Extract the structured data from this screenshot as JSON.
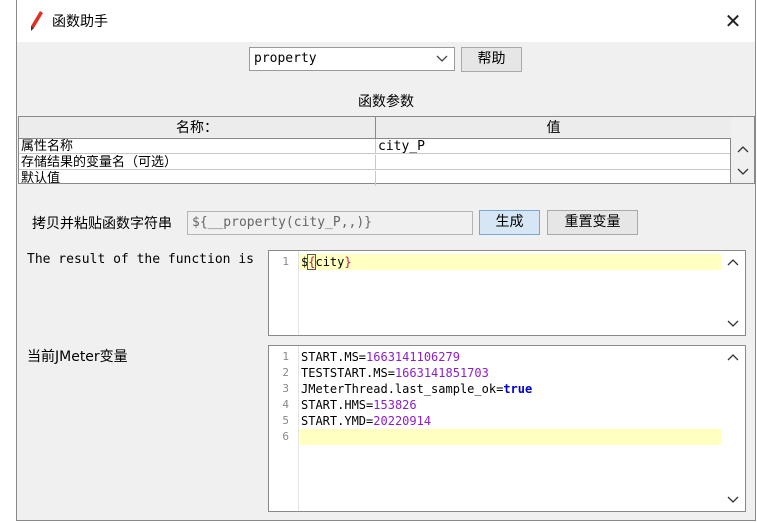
{
  "window": {
    "title": "函数助手",
    "close_icon": "close-icon"
  },
  "function_select": {
    "value": "property",
    "arrow_icon": "chevron-down-icon"
  },
  "help_button": {
    "label": "帮助"
  },
  "params": {
    "title": "函数参数",
    "columns": [
      "名称：",
      "值"
    ],
    "rows": [
      {
        "name": "属性名称",
        "value": "city_P"
      },
      {
        "name": "存储结果的变量名（可选）",
        "value": ""
      },
      {
        "name": "默认值",
        "value": ""
      }
    ]
  },
  "copy_row": {
    "label": "拷贝并粘贴函数字符串",
    "value": "${__property(city_P,,)}",
    "generate_label": "生成",
    "reset_label": "重置变量"
  },
  "result": {
    "label": "The result of the function is",
    "lines": [
      {
        "num": "1",
        "prefix": "$",
        "brace_open": "{",
        "text": "city",
        "brace_close": "}"
      }
    ]
  },
  "vars": {
    "label": "当前JMeter变量",
    "lines": [
      {
        "num": "1",
        "key": "START.MS",
        "eq": "=",
        "value": "1663141106279"
      },
      {
        "num": "2",
        "key": "TESTSTART.MS",
        "eq": "=",
        "value": "1663141851703"
      },
      {
        "num": "3",
        "key": "JMeterThread.last_sample_ok",
        "eq": "=",
        "value": "true"
      },
      {
        "num": "4",
        "key": "START.HMS",
        "eq": "=",
        "value": "153826"
      },
      {
        "num": "5",
        "key": "START.YMD",
        "eq": "=",
        "value": "20220914"
      },
      {
        "num": "6",
        "key": "",
        "eq": "",
        "value": ""
      }
    ]
  },
  "colors": {
    "number": "#8b1fc8",
    "keyword": "#0000cc",
    "brace": "#c0185b",
    "current_line": "#ffffc0"
  }
}
